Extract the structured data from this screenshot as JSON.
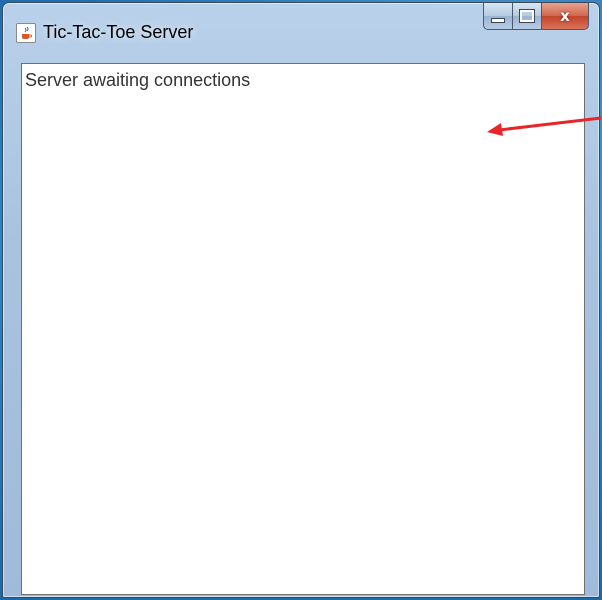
{
  "window": {
    "title": "Tic-Tac-Toe Server",
    "icon": "java-cup-icon",
    "buttons": {
      "minimize": "minimize",
      "maximize": "maximize",
      "close": "x"
    }
  },
  "content": {
    "status_text": "Server awaiting connections"
  },
  "annotation": {
    "arrow_color": "#e8262a"
  }
}
